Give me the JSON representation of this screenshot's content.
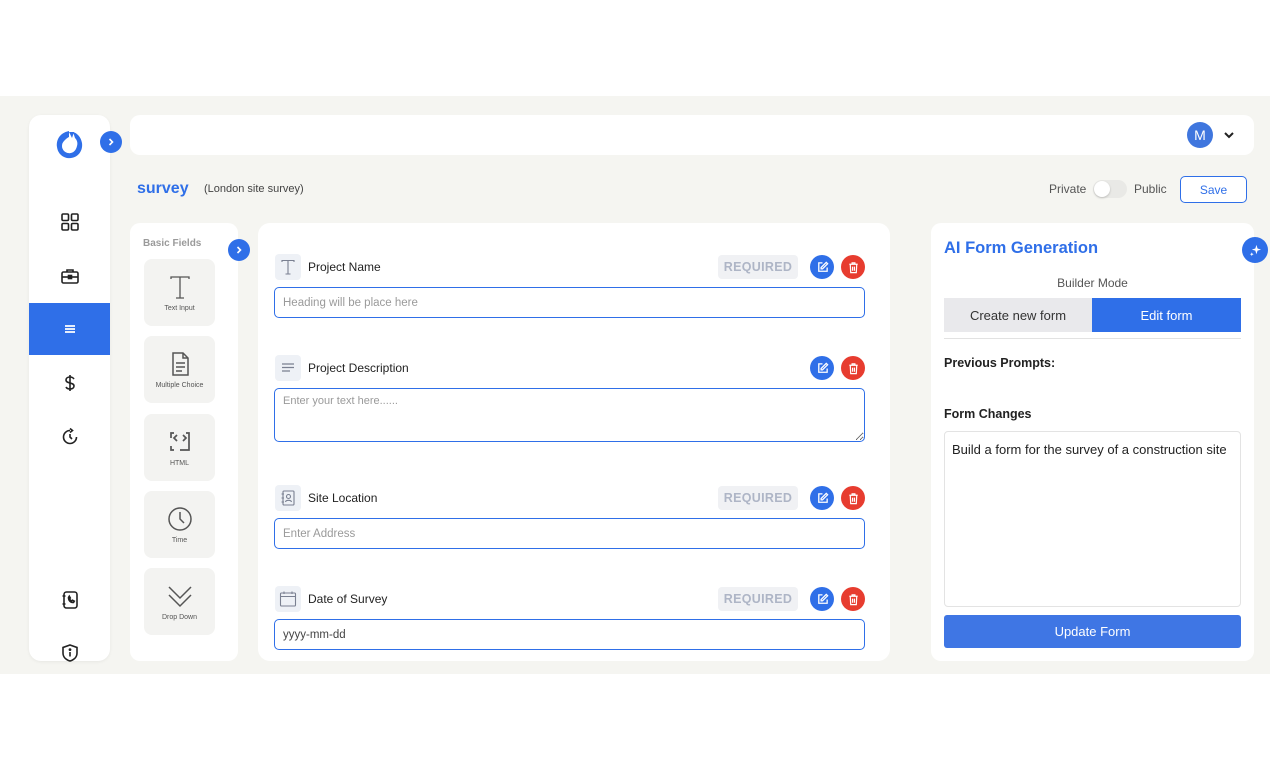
{
  "colors": {
    "accent": "#2f6fe8",
    "danger": "#e73c2f",
    "background": "#f5f5f1"
  },
  "nav": {
    "items": [
      {
        "icon": "dashboard-grid-icon"
      },
      {
        "icon": "briefcase-icon"
      },
      {
        "icon": "forms-menu-icon",
        "active": true
      },
      {
        "icon": "dollar-icon"
      },
      {
        "icon": "refresh-clock-icon"
      },
      {
        "icon": "phone-book-icon"
      },
      {
        "icon": "shield-info-icon"
      }
    ]
  },
  "header": {
    "avatar_initial": "M"
  },
  "form": {
    "title": "survey",
    "subtitle": "(London site survey)",
    "private_label": "Private",
    "public_label": "Public",
    "visibility": "private",
    "save_label": "Save"
  },
  "basic_fields": {
    "heading": "Basic Fields",
    "items": [
      {
        "label": "Text Input",
        "icon": "text-t-icon"
      },
      {
        "label": "Multiple Choice",
        "icon": "document-lines-icon"
      },
      {
        "label": "HTML",
        "icon": "html-code-icon"
      },
      {
        "label": "Time",
        "icon": "clock-icon"
      },
      {
        "label": "Drop Down",
        "icon": "chevron-down-icon"
      }
    ]
  },
  "fields": [
    {
      "label": "Project Name",
      "required_label": "REQUIRED",
      "placeholder": "Heading will be place here",
      "icon": "text-t-icon"
    },
    {
      "label": "Project Description",
      "placeholder": "Enter your text here......",
      "icon": "paragraph-lines-icon"
    },
    {
      "label": "Site Location",
      "required_label": "REQUIRED",
      "placeholder": "Enter Address",
      "icon": "address-book-icon"
    },
    {
      "label": "Date of Survey",
      "required_label": "REQUIRED",
      "value": "yyyy-mm-dd",
      "icon": "calendar-icon"
    }
  ],
  "ai_panel": {
    "title": "AI Form Generation",
    "builder_mode_label": "Builder Mode",
    "tabs": [
      {
        "label": "Create new form",
        "active": false
      },
      {
        "label": "Edit form",
        "active": true
      }
    ],
    "previous_prompts_label": "Previous Prompts:",
    "form_changes_label": "Form Changes",
    "prompt_text": "Build a form for the survey of a construction site",
    "update_button_label": "Update Form"
  }
}
